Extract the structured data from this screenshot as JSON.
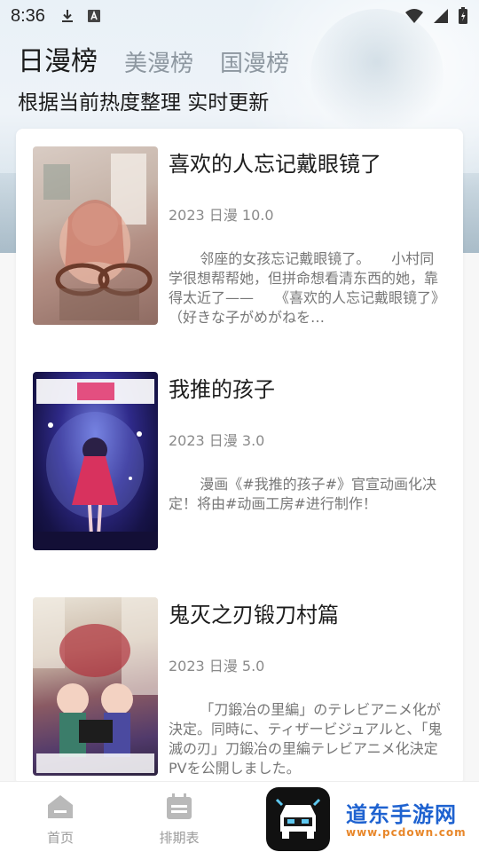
{
  "status_bar": {
    "time": "8:36"
  },
  "tabs": [
    {
      "label": "日漫榜",
      "active": true
    },
    {
      "label": "美漫榜",
      "active": false
    },
    {
      "label": "国漫榜",
      "active": false
    }
  ],
  "subtitle": "根据当前热度整理 实时更新",
  "items": [
    {
      "title": "喜欢的人忘记戴眼镜了",
      "meta": "2023 日漫 10.0",
      "description": "邻座的女孩忘记戴眼镜了。　　小村同学很想帮帮她，但拼命想看清东西的她，靠得太近了——　　《喜欢的人忘记戴眼镜了》（好きな子がめがねを…",
      "cover_icon": "anime-poster-girl-glasses"
    },
    {
      "title": "我推的孩子",
      "meta": "2023 日漫 3.0",
      "description": "漫画《#我推的孩子#》官宣动画化决定！将由#动画工房#进行制作！",
      "cover_icon": "anime-poster-idol-stage"
    },
    {
      "title": "鬼灭之刃锻刀村篇",
      "meta": "2023 日漫 5.0",
      "description": "「刀鍛冶の里編」のテレビアニメ化が決定。同時に、ティザービジュアルと、「鬼滅の刃」刀鍛冶の里編テレビアニメ化決定 PVを公開しました。",
      "cover_icon": "anime-poster-demon-slayer"
    }
  ],
  "bottom_nav": {
    "home_label": "首页",
    "schedule_label": "排期表"
  },
  "watermark": {
    "main": "道东手游网",
    "sub": "www.pcdown.com"
  },
  "colors": {
    "active_tab": "#1b1b1b",
    "inactive_tab": "#8d97a0",
    "card_bg": "#ffffff"
  }
}
